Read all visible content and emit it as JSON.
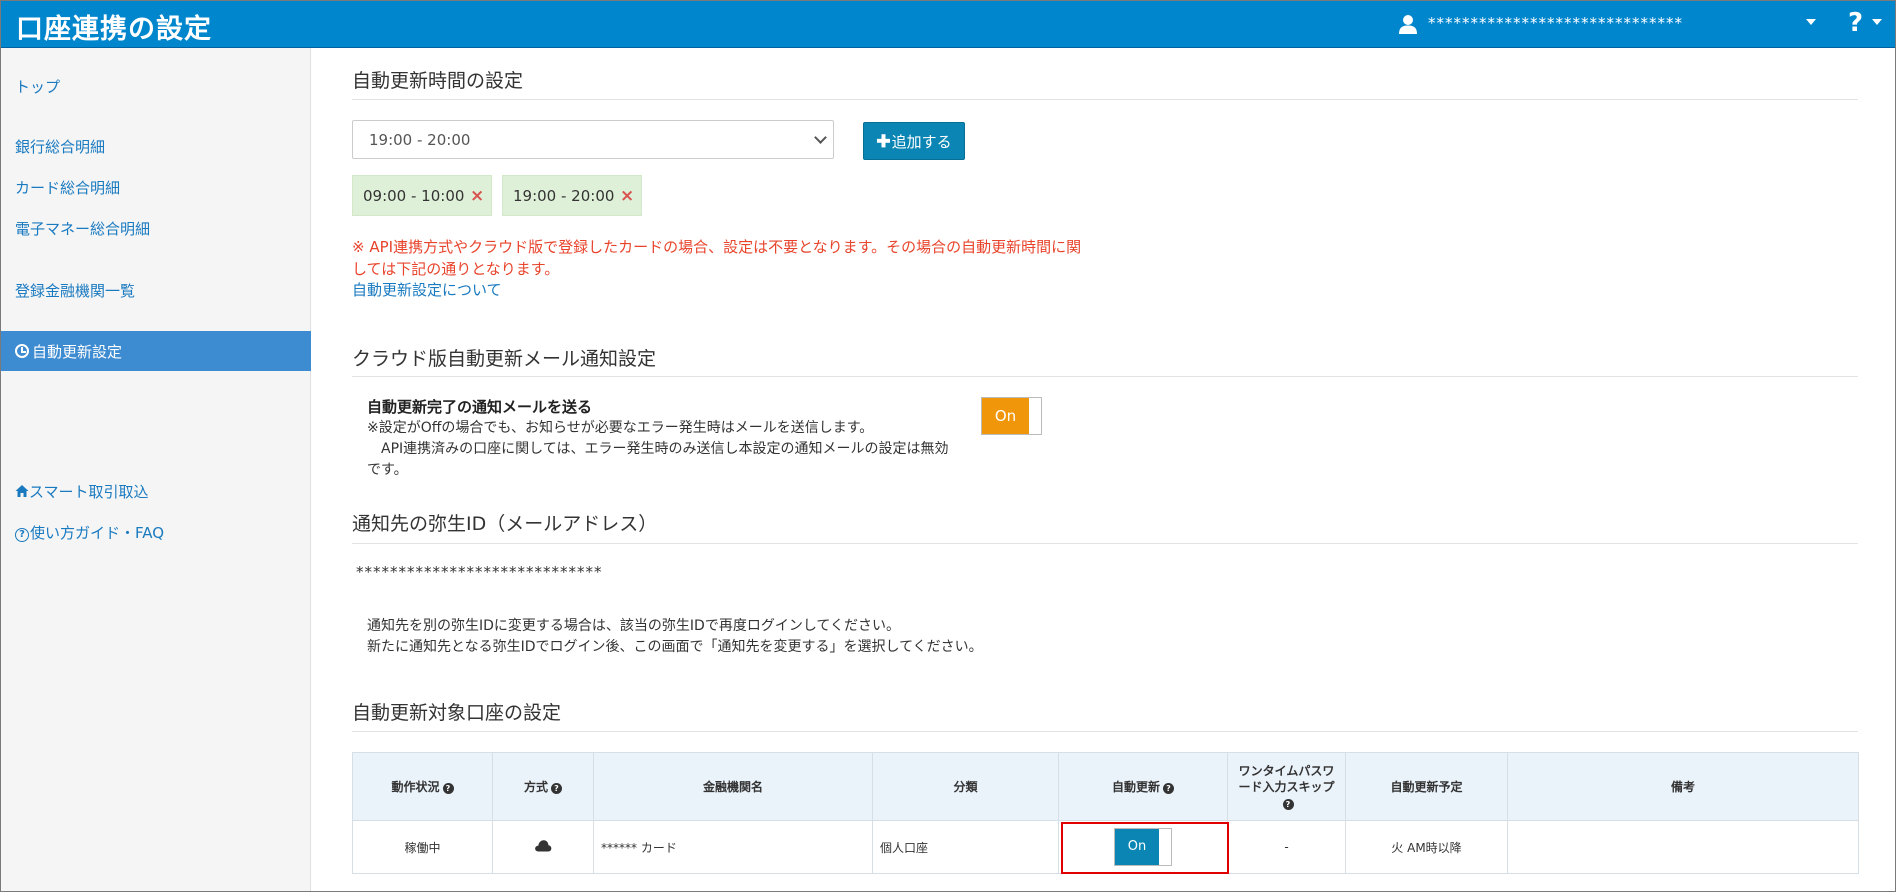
{
  "header": {
    "title": "口座連携の設定",
    "user_name": "******************************",
    "user_icon": "user-icon",
    "help_label": "?"
  },
  "sidebar": {
    "items": [
      {
        "label": "トップ"
      },
      {
        "label": "銀行総合明細"
      },
      {
        "label": "カード総合明細"
      },
      {
        "label": "電子マネー総合明細"
      },
      {
        "label": "登録金融機関一覧"
      },
      {
        "label": "自動更新設定",
        "active": true,
        "icon": "clock-icon"
      },
      {
        "label": "スマート取引取込",
        "icon": "home-icon"
      },
      {
        "label": "使い方ガイド・FAQ",
        "icon": "question-circle-icon"
      }
    ]
  },
  "schedule": {
    "title": "自動更新時間の設定",
    "selected_time": "19:00 - 20:00",
    "add_label": "追加する",
    "chips": [
      "09:00 - 10:00",
      "19:00 - 20:00"
    ],
    "remove_symbol": "×",
    "notice": "※ API連携方式やクラウド版で登録したカードの場合、設定は不要となります。その場合の自動更新時間に関しては下記の通りとなります。",
    "link": "自動更新設定について"
  },
  "mail": {
    "title": "クラウド版自動更新メール通知設定",
    "label": "自動更新完了の通知メールを送る",
    "desc_line1": "※設定がOffの場合でも、お知らせが必要なエラー発生時はメールを送信します。",
    "desc_line2": "API連携済みの口座に関しては、エラー発生時のみ送信し本設定の通知メールの設定は無効です。",
    "toggle": "On"
  },
  "notify_id": {
    "title": "通知先の弥生ID（メールアドレス）",
    "value": "*****************************",
    "desc_line1": "通知先を別の弥生IDに変更する場合は、該当の弥生IDで再度ログインしてください。",
    "desc_line2": "新たに通知先となる弥生IDでログイン後、この画面で「通知先を変更する」を選択してください。"
  },
  "accounts": {
    "title": "自動更新対象口座の設定",
    "headers": [
      "動作状況",
      "方式",
      "金融機関名",
      "分類",
      "自動更新",
      "ワンタイムパスワード入力スキップ",
      "自動更新予定",
      "備考"
    ],
    "rows": [
      {
        "status": "稼働中",
        "method_icon": "cloud-icon",
        "institution": "****** カード",
        "category": "個人口座",
        "auto": "On",
        "otp": "-",
        "schedule": "火 AM時以降",
        "note": ""
      }
    ]
  },
  "colors": {
    "header_bg": "#0086cc",
    "sidebar_active": "#3d8bd0",
    "link": "#1a7ac0",
    "notice": "#e8442c",
    "toggle_orange": "#f0960a",
    "toggle_blue": "#0b86b4",
    "chip_bg": "#dff0d8",
    "highlight": "#e00000"
  }
}
